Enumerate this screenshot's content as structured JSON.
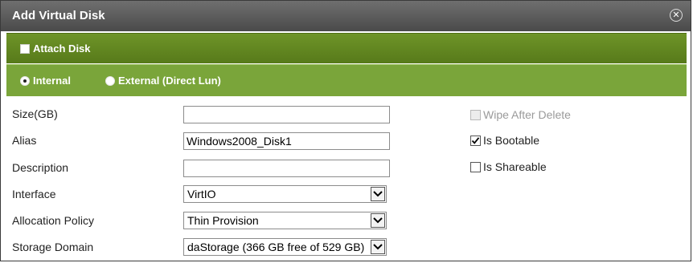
{
  "dialog": {
    "title": "Add Virtual Disk",
    "close_icon": "close-icon"
  },
  "attach": {
    "label": "Attach Disk",
    "checked": false
  },
  "disk_type": {
    "options": [
      {
        "label": "Internal",
        "selected": true
      },
      {
        "label": "External (Direct Lun)",
        "selected": false
      }
    ]
  },
  "form": {
    "size": {
      "label": "Size(GB)",
      "value": ""
    },
    "alias": {
      "label": "Alias",
      "value": "Windows2008_Disk1"
    },
    "description": {
      "label": "Description",
      "value": ""
    },
    "interface": {
      "label": "Interface",
      "value": "VirtIO"
    },
    "allocation_policy": {
      "label": "Allocation Policy",
      "value": "Thin Provision"
    },
    "storage_domain": {
      "label": "Storage Domain",
      "value": "daStorage (366 GB free of 529 GB)"
    }
  },
  "options": {
    "wipe_after_delete": {
      "label": "Wipe After Delete",
      "checked": false,
      "disabled": true
    },
    "is_bootable": {
      "label": "Is Bootable",
      "checked": true,
      "disabled": false
    },
    "is_shareable": {
      "label": "Is Shareable",
      "checked": false,
      "disabled": false
    }
  },
  "colors": {
    "title_bar": "#555555",
    "band_dark": "#62871f",
    "band_light": "#7aa53a"
  }
}
